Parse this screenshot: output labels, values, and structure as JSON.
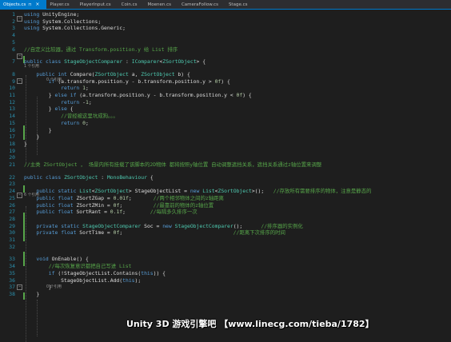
{
  "tabs": [
    {
      "label": "Objects.cs",
      "active": true,
      "close": "×",
      "pin": "⊓"
    },
    {
      "label": "Player.cs",
      "active": false
    },
    {
      "label": "PlayerInput.cs",
      "active": false
    },
    {
      "label": "Coin.cs",
      "active": false
    },
    {
      "label": "Moenen.cs",
      "active": false
    },
    {
      "label": "CameraFollow.cs",
      "active": false
    },
    {
      "label": "Stage.cs",
      "active": false
    }
  ],
  "colors": {
    "background": "#1e1e1e",
    "keyword": "#569cd6",
    "type": "#4ec9b0",
    "comment": "#57a64a",
    "number": "#b5cea8",
    "text": "#dcdcdc",
    "line_number": "#2b91af",
    "accent": "#007acc"
  },
  "lines": [
    {
      "n": "1",
      "tokens": [
        [
          "kw",
          "using"
        ],
        [
          "tx",
          " UnityEngine;"
        ]
      ]
    },
    {
      "n": "2",
      "tokens": [
        [
          "kw",
          "using"
        ],
        [
          "tx",
          " System.Collections;"
        ]
      ]
    },
    {
      "n": "3",
      "tokens": [
        [
          "kw",
          "using"
        ],
        [
          "tx",
          " System.Collections.Generic;"
        ]
      ]
    },
    {
      "n": "4",
      "tokens": []
    },
    {
      "n": "5",
      "tokens": []
    },
    {
      "n": "6",
      "tokens": [
        [
          "cm",
          "//自定义比较器，通过 Transform.position.y 给 List 排序"
        ]
      ]
    },
    {
      "n": "7",
      "tokens": [
        [
          "kw",
          "public"
        ],
        [
          "tx",
          " "
        ],
        [
          "kw",
          "class"
        ],
        [
          "tx",
          " "
        ],
        [
          "ty",
          "StageObjectComparer"
        ],
        [
          "tx",
          " : "
        ],
        [
          "ty",
          "IComparer"
        ],
        [
          "tx",
          "<"
        ],
        [
          "ty",
          "ZSortObject"
        ],
        [
          "tx",
          "> {"
        ]
      ]
    },
    {
      "n": "8",
      "tokens": [
        [
          "tx",
          "    "
        ],
        [
          "kw",
          "public"
        ],
        [
          "tx",
          " "
        ],
        [
          "kw",
          "int"
        ],
        [
          "tx",
          " Compare("
        ],
        [
          "ty",
          "ZSortObject"
        ],
        [
          "tx",
          " a, "
        ],
        [
          "ty",
          "ZSortObject"
        ],
        [
          "tx",
          " b) {"
        ]
      ]
    },
    {
      "n": "9",
      "tokens": [
        [
          "tx",
          "        "
        ],
        [
          "kw",
          "if"
        ],
        [
          "tx",
          " (a.transform.position.y - b.transform.position.y > "
        ],
        [
          "nm",
          "0f"
        ],
        [
          "tx",
          ") {"
        ]
      ]
    },
    {
      "n": "10",
      "tokens": [
        [
          "tx",
          "            "
        ],
        [
          "kw",
          "return"
        ],
        [
          "tx",
          " "
        ],
        [
          "nm",
          "1"
        ],
        [
          "tx",
          ";"
        ]
      ]
    },
    {
      "n": "11",
      "tokens": [
        [
          "tx",
          "        } "
        ],
        [
          "kw",
          "else"
        ],
        [
          "tx",
          " "
        ],
        [
          "kw",
          "if"
        ],
        [
          "tx",
          " (a.transform.position.y - b.transform.position.y < "
        ],
        [
          "nm",
          "0f"
        ],
        [
          "tx",
          ") {"
        ]
      ]
    },
    {
      "n": "12",
      "tokens": [
        [
          "tx",
          "            "
        ],
        [
          "kw",
          "return"
        ],
        [
          "tx",
          " -"
        ],
        [
          "nm",
          "1"
        ],
        [
          "tx",
          ";"
        ]
      ]
    },
    {
      "n": "13",
      "tokens": [
        [
          "tx",
          "        } "
        ],
        [
          "kw",
          "else"
        ],
        [
          "tx",
          " {"
        ]
      ]
    },
    {
      "n": "14",
      "tokens": [
        [
          "tx",
          "            "
        ],
        [
          "cm",
          "//曾经被这里坑成狗。。。"
        ]
      ]
    },
    {
      "n": "15",
      "tokens": [
        [
          "tx",
          "            "
        ],
        [
          "kw",
          "return"
        ],
        [
          "tx",
          " "
        ],
        [
          "nm",
          "0"
        ],
        [
          "tx",
          ";"
        ]
      ]
    },
    {
      "n": "16",
      "tokens": [
        [
          "tx",
          "        }"
        ]
      ]
    },
    {
      "n": "17",
      "tokens": [
        [
          "tx",
          "    }"
        ]
      ]
    },
    {
      "n": "18",
      "tokens": [
        [
          "tx",
          "}"
        ]
      ]
    },
    {
      "n": "19",
      "tokens": []
    },
    {
      "n": "20",
      "tokens": []
    },
    {
      "n": "21",
      "tokens": [
        [
          "cm",
          "//主类 ZSortObject ， 场景内所有挂载了该脚本的2D物体 都将按照y轴位置 自动调整遮挡关系，遮挡关系通过z轴位置来调整"
        ]
      ]
    },
    {
      "n": "22",
      "tokens": [
        [
          "kw",
          "public"
        ],
        [
          "tx",
          " "
        ],
        [
          "kw",
          "class"
        ],
        [
          "tx",
          " "
        ],
        [
          "ty",
          "ZSortObject"
        ],
        [
          "tx",
          " : "
        ],
        [
          "ty",
          "MonoBehaviour"
        ],
        [
          "tx",
          " {"
        ]
      ]
    },
    {
      "n": "23",
      "tokens": []
    },
    {
      "n": "24",
      "tokens": [
        [
          "tx",
          "    "
        ],
        [
          "kw",
          "public"
        ],
        [
          "tx",
          " "
        ],
        [
          "kw",
          "static"
        ],
        [
          "tx",
          " "
        ],
        [
          "ty",
          "List"
        ],
        [
          "tx",
          "<"
        ],
        [
          "ty",
          "ZSortObject"
        ],
        [
          "tx",
          "> StageObjectList = "
        ],
        [
          "kw",
          "new"
        ],
        [
          "tx",
          " "
        ],
        [
          "ty",
          "List"
        ],
        [
          "tx",
          "<"
        ],
        [
          "ty",
          "ZSortObject"
        ],
        [
          "tx",
          ">();   "
        ],
        [
          "cm",
          "//存放所有需要排序的物体，注意是静态的"
        ]
      ]
    },
    {
      "n": "25",
      "tokens": [
        [
          "tx",
          "    "
        ],
        [
          "kw",
          "public"
        ],
        [
          "tx",
          " "
        ],
        [
          "kw",
          "float"
        ],
        [
          "tx",
          " ZSortZGap = "
        ],
        [
          "nm",
          "0.01f"
        ],
        [
          "tx",
          ";       "
        ],
        [
          "cm",
          "//两个相邻物体之间的z轴距离"
        ]
      ]
    },
    {
      "n": "26",
      "tokens": [
        [
          "tx",
          "    "
        ],
        [
          "kw",
          "public"
        ],
        [
          "tx",
          " "
        ],
        [
          "kw",
          "float"
        ],
        [
          "tx",
          " ZSortZMin = "
        ],
        [
          "nm",
          "0f"
        ],
        [
          "tx",
          ";          "
        ],
        [
          "cm",
          "//最靠前的物体的z轴位置"
        ]
      ]
    },
    {
      "n": "27",
      "tokens": [
        [
          "tx",
          "    "
        ],
        [
          "kw",
          "public"
        ],
        [
          "tx",
          " "
        ],
        [
          "kw",
          "float"
        ],
        [
          "tx",
          " SortRant = "
        ],
        [
          "nm",
          "0.1f"
        ],
        [
          "tx",
          ";        "
        ],
        [
          "cm",
          "//每隔多久排序一次"
        ]
      ]
    },
    {
      "n": "28",
      "tokens": []
    },
    {
      "n": "29",
      "tokens": [
        [
          "tx",
          "    "
        ],
        [
          "kw",
          "private"
        ],
        [
          "tx",
          " "
        ],
        [
          "kw",
          "static"
        ],
        [
          "tx",
          " "
        ],
        [
          "ty",
          "StageObjectComparer"
        ],
        [
          "tx",
          " Soc = "
        ],
        [
          "kw",
          "new"
        ],
        [
          "tx",
          " "
        ],
        [
          "ty",
          "StageObjectComparer"
        ],
        [
          "tx",
          "();      "
        ],
        [
          "cm",
          "//排序器的实例化"
        ]
      ]
    },
    {
      "n": "30",
      "tokens": [
        [
          "tx",
          "    "
        ],
        [
          "kw",
          "private"
        ],
        [
          "tx",
          " "
        ],
        [
          "kw",
          "float"
        ],
        [
          "tx",
          " SortTime = "
        ],
        [
          "nm",
          "0f"
        ],
        [
          "tx",
          ";                                    "
        ],
        [
          "cm",
          "//距离下次排序的时间"
        ]
      ]
    },
    {
      "n": "31",
      "tokens": []
    },
    {
      "n": "32",
      "tokens": []
    },
    {
      "n": "33",
      "tokens": [
        [
          "tx",
          "    "
        ],
        [
          "kw",
          "void"
        ],
        [
          "tx",
          " OnEnable() {"
        ]
      ]
    },
    {
      "n": "34",
      "tokens": [
        [
          "tx",
          "        "
        ],
        [
          "cm",
          "//每次恢复意识都把自己写进 List"
        ]
      ]
    },
    {
      "n": "35",
      "tokens": [
        [
          "tx",
          "        "
        ],
        [
          "kw",
          "if"
        ],
        [
          "tx",
          " (!StageObjectList.Contains("
        ],
        [
          "kw",
          "this"
        ],
        [
          "tx",
          ")) {"
        ]
      ]
    },
    {
      "n": "36",
      "tokens": [
        [
          "tx",
          "            StageObjectList.Add("
        ],
        [
          "kw",
          "this"
        ],
        [
          "tx",
          ");"
        ]
      ]
    },
    {
      "n": "37",
      "tokens": [
        [
          "tx",
          "        }"
        ]
      ]
    },
    {
      "n": "38",
      "tokens": [
        [
          "tx",
          "    }"
        ]
      ]
    }
  ],
  "codelens": {
    "refs_7": "1 个引用",
    "refs_8": "0 个引用",
    "refs_22": "6 个引用",
    "refs_33": "0 个引用"
  },
  "watermark": "Unity 3D 游戏引擎吧 【www.linecg.com/tieba/1782】"
}
